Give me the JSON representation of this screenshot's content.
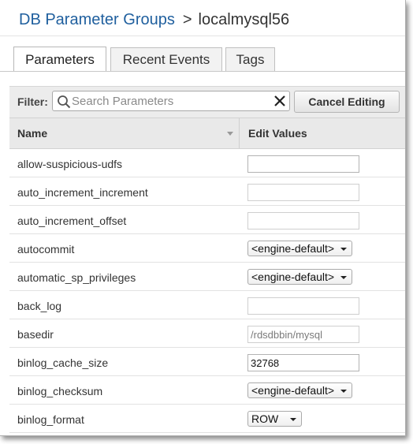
{
  "breadcrumb": {
    "parent": "DB Parameter Groups",
    "separator": ">",
    "current": "localmysql56"
  },
  "tabs": [
    {
      "label": "Parameters",
      "active": true
    },
    {
      "label": "Recent Events",
      "active": false
    },
    {
      "label": "Tags",
      "active": false
    }
  ],
  "filter": {
    "label": "Filter:",
    "placeholder": "Search Parameters",
    "value": "",
    "search_icon": "search-icon",
    "clear_icon": "close-icon"
  },
  "cancel_button": "Cancel Editing",
  "table": {
    "columns": [
      "Name",
      "Edit Values"
    ],
    "rows": [
      {
        "name": "allow-suspicious-udfs",
        "control": "text",
        "value": "",
        "editable": true
      },
      {
        "name": "auto_increment_increment",
        "control": "text",
        "value": "",
        "editable": false
      },
      {
        "name": "auto_increment_offset",
        "control": "text",
        "value": "",
        "editable": false
      },
      {
        "name": "autocommit",
        "control": "select",
        "value": "<engine-default>"
      },
      {
        "name": "automatic_sp_privileges",
        "control": "select",
        "value": "<engine-default>"
      },
      {
        "name": "back_log",
        "control": "text",
        "value": "",
        "editable": false
      },
      {
        "name": "basedir",
        "control": "text",
        "value": "/rdsdbbin/mysql",
        "editable": false
      },
      {
        "name": "binlog_cache_size",
        "control": "text",
        "value": "32768",
        "editable": true
      },
      {
        "name": "binlog_checksum",
        "control": "select",
        "value": "<engine-default>"
      },
      {
        "name": "binlog_format",
        "control": "select",
        "value": "ROW"
      }
    ]
  },
  "colors": {
    "link": "#1f5f9e",
    "header_bg": "#e9e9e9",
    "filter_bg": "#ececec"
  }
}
